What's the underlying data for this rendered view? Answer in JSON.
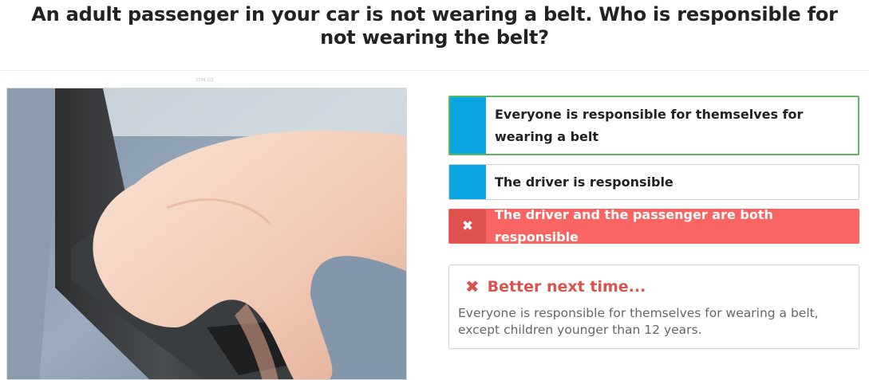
{
  "question": {
    "text": "An adult passenger in your car is not wearing a belt. Who is responsible for not wearing the belt?"
  },
  "image": {
    "caption": "2704.1/2",
    "description_icon": "seatbelt-photo"
  },
  "answers": [
    {
      "label": "Everyone is responsible for themselves for wearing a belt",
      "state": "correct"
    },
    {
      "label": "The driver is responsible",
      "state": "neutral"
    },
    {
      "label": "The driver and the passenger are both responsible",
      "state": "selected-wrong",
      "icon": "cross-icon",
      "icon_glyph": "✖"
    }
  ],
  "feedback": {
    "icon": "cross-icon",
    "icon_glyph": "✖",
    "title": "Better next time...",
    "body": "Everyone is responsible for themselves for wearing a belt, except children younger than 12 years."
  },
  "colors": {
    "answer_marker": "#0aa5e2",
    "correct_border": "#5cb85c",
    "wrong_bg": "#f96562",
    "feedback_title": "#d9534f"
  }
}
